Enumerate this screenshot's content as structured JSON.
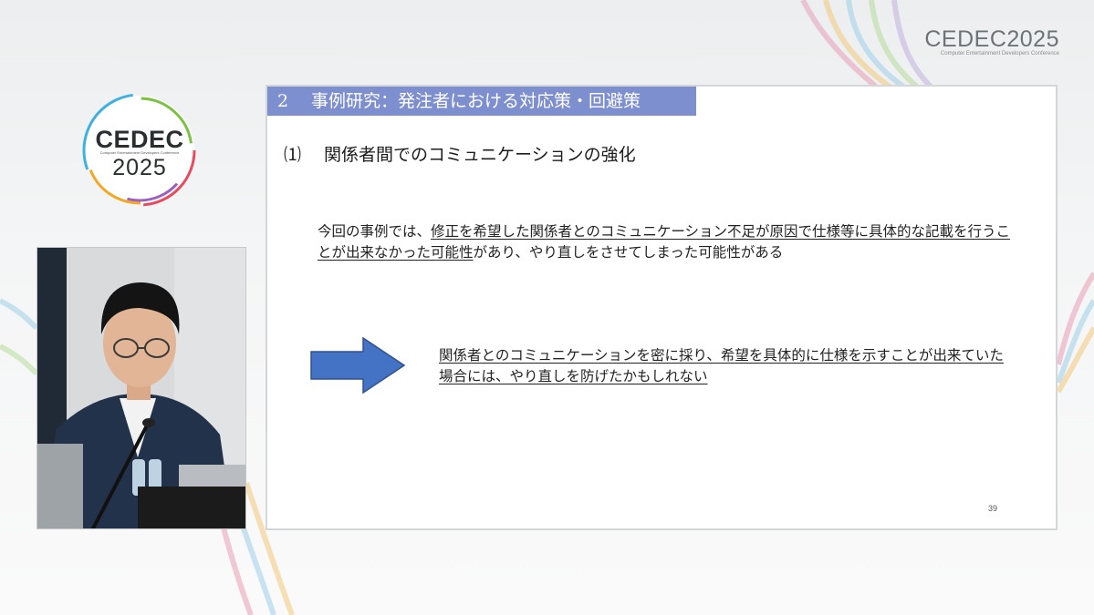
{
  "event": {
    "logo_text": "CEDEC2025",
    "logo_subtitle": "Computer Entertainment Developers Conference",
    "ring_logo_line1": "CEDEC",
    "ring_logo_line2": "2025",
    "ring_logo_small": "Computer Entertainment Developers Conference"
  },
  "slide": {
    "header_number": "2",
    "header_title": "事例研究：発注者における対応策・回避策",
    "subheading_number": "⑴",
    "subheading": "関係者間でのコミュニケーションの強化",
    "paragraph": {
      "prefix": "今回の事例では、",
      "underlined": "修正を希望した関係者とのコミュニケーション不足が原因で仕様等に具体的な記載を行うことが出来なかった可能性",
      "suffix": "があり、やり直しをさせてしまった可能性がある"
    },
    "conclusion": "関係者とのコミュニケーションを密に採り、希望を具体的に仕様を示すことが出来ていた場合には、やり直しを防げたかもしれない",
    "page_number": "39"
  },
  "colors": {
    "header_bg": "#7e8fcf",
    "arrow_fill": "#4472c4",
    "arrow_stroke": "#2f528f"
  }
}
